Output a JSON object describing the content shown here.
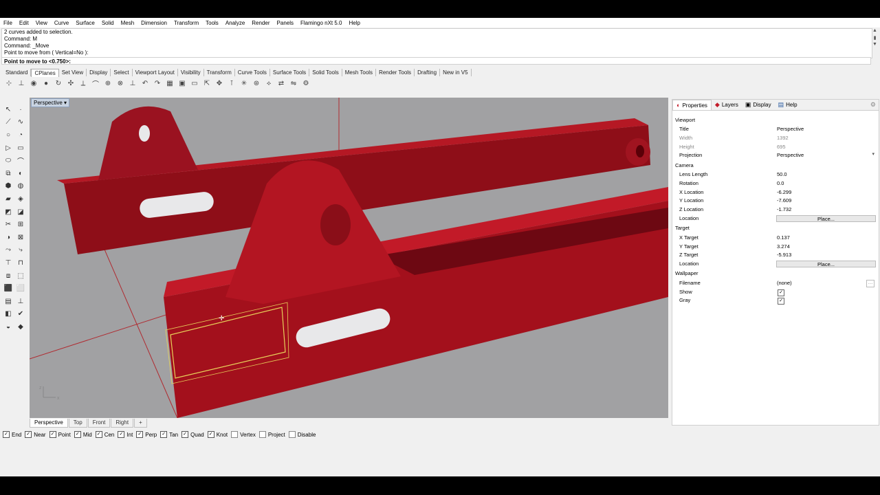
{
  "menu": [
    "File",
    "Edit",
    "View",
    "Curve",
    "Surface",
    "Solid",
    "Mesh",
    "Dimension",
    "Transform",
    "Tools",
    "Analyze",
    "Render",
    "Panels",
    "Flamingo nXt 5.0",
    "Help"
  ],
  "command_history": [
    "2 curves added to selection.",
    "Command: M",
    "Command: _Move",
    "Point to move from ( Vertical=No ):"
  ],
  "command_prompt": "Point to move to <0.750>:",
  "toolbar_tabs": [
    "Standard",
    "CPlanes",
    "Set View",
    "Display",
    "Select",
    "Viewport Layout",
    "Visibility",
    "Transform",
    "Curve Tools",
    "Surface Tools",
    "Solid Tools",
    "Mesh Tools",
    "Render Tools",
    "Drafting",
    "New in V5"
  ],
  "active_toolbar_tab": "CPlanes",
  "viewport": {
    "title": "Perspective",
    "tabs": [
      "Perspective",
      "Top",
      "Front",
      "Right"
    ],
    "add_tab": "+"
  },
  "osnaps": [
    {
      "label": "End",
      "checked": true
    },
    {
      "label": "Near",
      "checked": true
    },
    {
      "label": "Point",
      "checked": true
    },
    {
      "label": "Mid",
      "checked": true
    },
    {
      "label": "Cen",
      "checked": true
    },
    {
      "label": "Int",
      "checked": true
    },
    {
      "label": "Perp",
      "checked": true
    },
    {
      "label": "Tan",
      "checked": true
    },
    {
      "label": "Quad",
      "checked": true
    },
    {
      "label": "Knot",
      "checked": true
    },
    {
      "label": "Vertex",
      "checked": false
    },
    {
      "label": "Project",
      "checked": false
    },
    {
      "label": "Disable",
      "checked": false
    }
  ],
  "panel": {
    "tabs": [
      "Properties",
      "Layers",
      "Display",
      "Help"
    ],
    "viewport_section": "Viewport",
    "title_label": "Title",
    "title_value": "Perspective",
    "width_label": "Width",
    "width_value": "1392",
    "height_label": "Height",
    "height_value": "695",
    "projection_label": "Projection",
    "projection_value": "Perspective",
    "camera_section": "Camera",
    "lens_label": "Lens Length",
    "lens_value": "50.0",
    "rotation_label": "Rotation",
    "rotation_value": "0.0",
    "xloc_label": "X Location",
    "xloc_value": "-6.299",
    "yloc_label": "Y Location",
    "yloc_value": "-7.609",
    "zloc_label": "Z Location",
    "zloc_value": "-1.732",
    "location_label": "Location",
    "place_label": "Place...",
    "target_section": "Target",
    "xt_label": "X Target",
    "xt_value": "0.137",
    "yt_label": "Y Target",
    "yt_value": "3.274",
    "zt_label": "Z Target",
    "zt_value": "-5.913",
    "tlocation_label": "Location",
    "tplace_label": "Place...",
    "wallpaper_section": "Wallpaper",
    "filename_label": "Filename",
    "filename_value": "(none)",
    "show_label": "Show",
    "gray_label": "Gray"
  },
  "colors": {
    "model_red": "#a3101c",
    "viewport_bg": "#a1a1a3",
    "selection": "#e8d25a"
  }
}
